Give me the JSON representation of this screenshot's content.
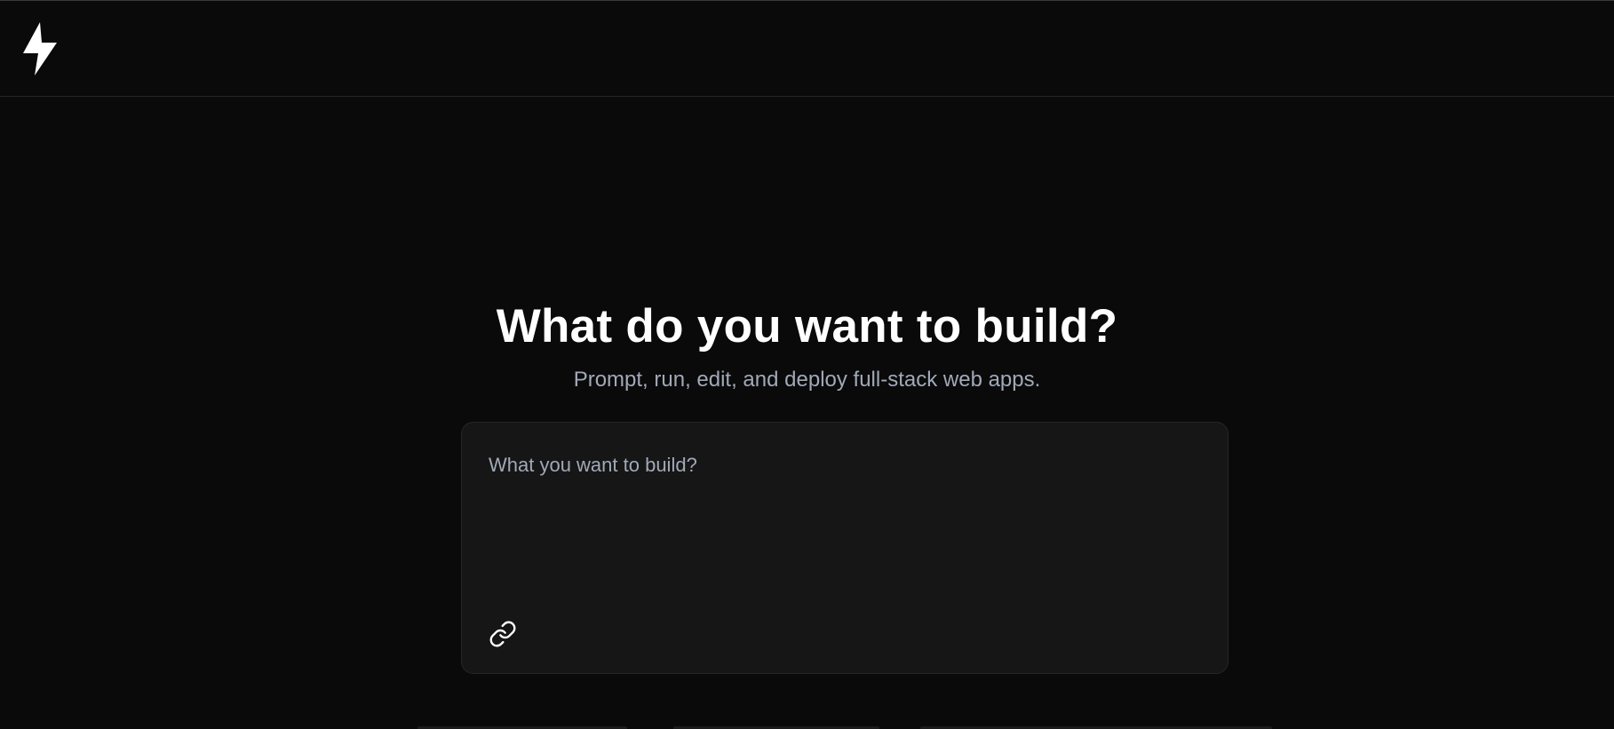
{
  "header": {
    "logo_icon": "lightning-bolt-icon"
  },
  "hero": {
    "title": "What do you want to build?",
    "subtitle": "Prompt, run, edit, and deploy full-stack web apps."
  },
  "prompt": {
    "placeholder": "What you want to build?",
    "value": "",
    "attach_icon": "link-icon"
  },
  "colors": {
    "background": "#0a0a0a",
    "panel": "#161616",
    "border": "#262626",
    "title": "#ffffff",
    "muted_text": "#a1a9b8"
  }
}
